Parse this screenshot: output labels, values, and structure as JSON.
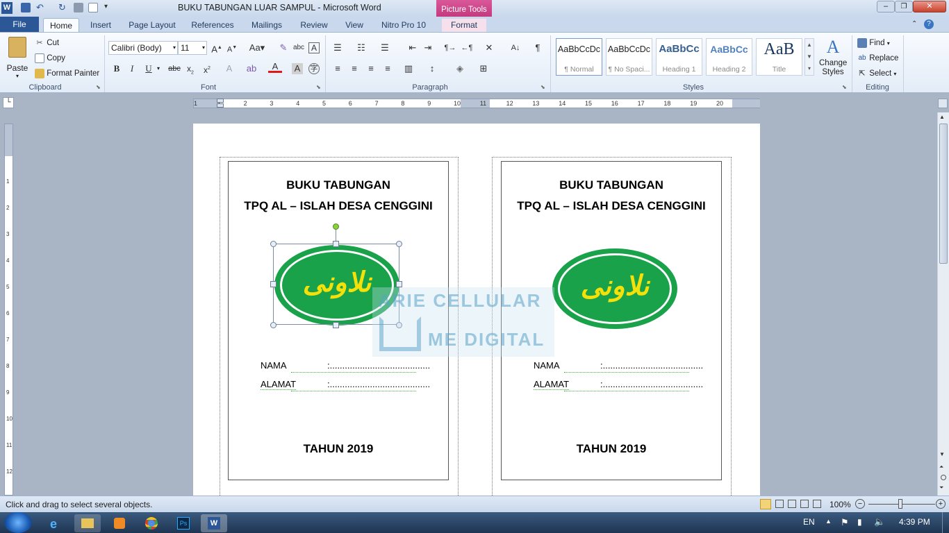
{
  "window": {
    "title": "BUKU TABUNGAN LUAR SAMPUL  -  Microsoft Word",
    "context_tab_group": "Picture Tools"
  },
  "tabs": [
    {
      "label": "File"
    },
    {
      "label": "Home"
    },
    {
      "label": "Insert"
    },
    {
      "label": "Page Layout"
    },
    {
      "label": "References"
    },
    {
      "label": "Mailings"
    },
    {
      "label": "Review"
    },
    {
      "label": "View"
    },
    {
      "label": "Nitro Pro 10"
    },
    {
      "label": "Format"
    }
  ],
  "clipboard": {
    "paste": "Paste",
    "cut": "Cut",
    "copy": "Copy",
    "format_painter": "Format Painter",
    "label": "Clipboard"
  },
  "font": {
    "name": "Calibri (Body)",
    "size": "11",
    "label": "Font"
  },
  "paragraph": {
    "label": "Paragraph"
  },
  "styles": {
    "label": "Styles",
    "items": [
      {
        "preview": "AaBbCcDc",
        "name": "¶ Normal"
      },
      {
        "preview": "AaBbCcDc",
        "name": "¶ No Spaci..."
      },
      {
        "preview": "AaBbCc",
        "name": "Heading 1"
      },
      {
        "preview": "AaBbCc",
        "name": "Heading 2"
      },
      {
        "preview": "AaB",
        "name": "Title"
      }
    ],
    "change": "Change Styles"
  },
  "editing": {
    "find": "Find",
    "replace": "Replace",
    "select": "Select",
    "label": "Editing"
  },
  "ruler": {
    "h_ticks": [
      "1",
      "1",
      "2",
      "3",
      "4",
      "5",
      "6",
      "7",
      "8",
      "9",
      "10",
      "11",
      "12",
      "13",
      "14",
      "15",
      "16",
      "17",
      "18",
      "19",
      "20"
    ],
    "v_ticks": [
      "1",
      "2",
      "3",
      "4",
      "5",
      "6",
      "7",
      "8",
      "9",
      "10",
      "11",
      "12"
    ]
  },
  "document": {
    "cards": [
      {
        "title1": "BUKU TABUNGAN",
        "title2": "TPQ AL – ISLAH DESA CENGGINI",
        "logo_text": "ﻧﻼﻭﻧﻰ",
        "nama": "NAMA",
        "nama_fill": ":........................................",
        "alamat": "ALAMAT",
        "alamat_fill": ":........................................",
        "year": "TAHUN 2019"
      },
      {
        "title1": "BUKU TABUNGAN",
        "title2": "TPQ AL – ISLAH DESA CENGGINI",
        "logo_text": "ﻧﻼﻭﻧﻰ",
        "nama": "NAMA",
        "nama_fill": ":........................................",
        "alamat": "ALAMAT",
        "alamat_fill": ":........................................",
        "year": "TAHUN 2019"
      }
    ],
    "watermark1": "ARIE CELLULAR",
    "watermark2": "ME DIGITAL"
  },
  "status": {
    "message": "Click and drag to select several objects.",
    "zoom": "100%"
  },
  "taskbar": {
    "lang": "EN",
    "time": "4:39 PM"
  },
  "colors": {
    "accent": "#2b5797",
    "logo_green": "#19a24a",
    "logo_text": "#f5e10a",
    "context_tab": "#c0357a"
  }
}
